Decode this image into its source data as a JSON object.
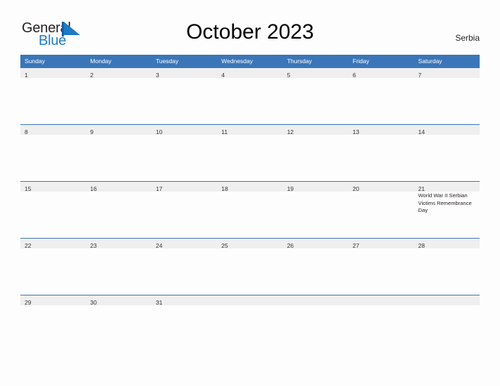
{
  "brand": {
    "name_top": "General",
    "name_bottom": "Blue",
    "flag_icon": "blue-triangle-flag-icon",
    "color_top": "#231f20",
    "color_bottom": "#1f7ac4"
  },
  "header": {
    "title": "October 2023",
    "country": "Serbia"
  },
  "colors": {
    "header_blue": "#3a76b8",
    "date_band_gray": "#efefef",
    "page_background": "#fdfdfd",
    "text_dark": "#231f20"
  },
  "calendar": {
    "weekdays": [
      "Sunday",
      "Monday",
      "Tuesday",
      "Wednesday",
      "Thursday",
      "Friday",
      "Saturday"
    ],
    "weeks": [
      {
        "days": [
          {
            "num": "1",
            "events": []
          },
          {
            "num": "2",
            "events": []
          },
          {
            "num": "3",
            "events": []
          },
          {
            "num": "4",
            "events": []
          },
          {
            "num": "5",
            "events": []
          },
          {
            "num": "6",
            "events": []
          },
          {
            "num": "7",
            "events": []
          }
        ]
      },
      {
        "days": [
          {
            "num": "8",
            "events": []
          },
          {
            "num": "9",
            "events": []
          },
          {
            "num": "10",
            "events": []
          },
          {
            "num": "11",
            "events": []
          },
          {
            "num": "12",
            "events": []
          },
          {
            "num": "13",
            "events": []
          },
          {
            "num": "14",
            "events": []
          }
        ]
      },
      {
        "days": [
          {
            "num": "15",
            "events": []
          },
          {
            "num": "16",
            "events": []
          },
          {
            "num": "17",
            "events": []
          },
          {
            "num": "18",
            "events": []
          },
          {
            "num": "19",
            "events": []
          },
          {
            "num": "20",
            "events": []
          },
          {
            "num": "21",
            "events": [
              "World War II Serbian Victims Remembrance Day"
            ]
          }
        ]
      },
      {
        "days": [
          {
            "num": "22",
            "events": []
          },
          {
            "num": "23",
            "events": []
          },
          {
            "num": "24",
            "events": []
          },
          {
            "num": "25",
            "events": []
          },
          {
            "num": "26",
            "events": []
          },
          {
            "num": "27",
            "events": []
          },
          {
            "num": "28",
            "events": []
          }
        ]
      },
      {
        "days": [
          {
            "num": "29",
            "events": []
          },
          {
            "num": "30",
            "events": []
          },
          {
            "num": "31",
            "events": []
          },
          {
            "num": "",
            "events": []
          },
          {
            "num": "",
            "events": []
          },
          {
            "num": "",
            "events": []
          },
          {
            "num": "",
            "events": []
          }
        ]
      }
    ]
  }
}
